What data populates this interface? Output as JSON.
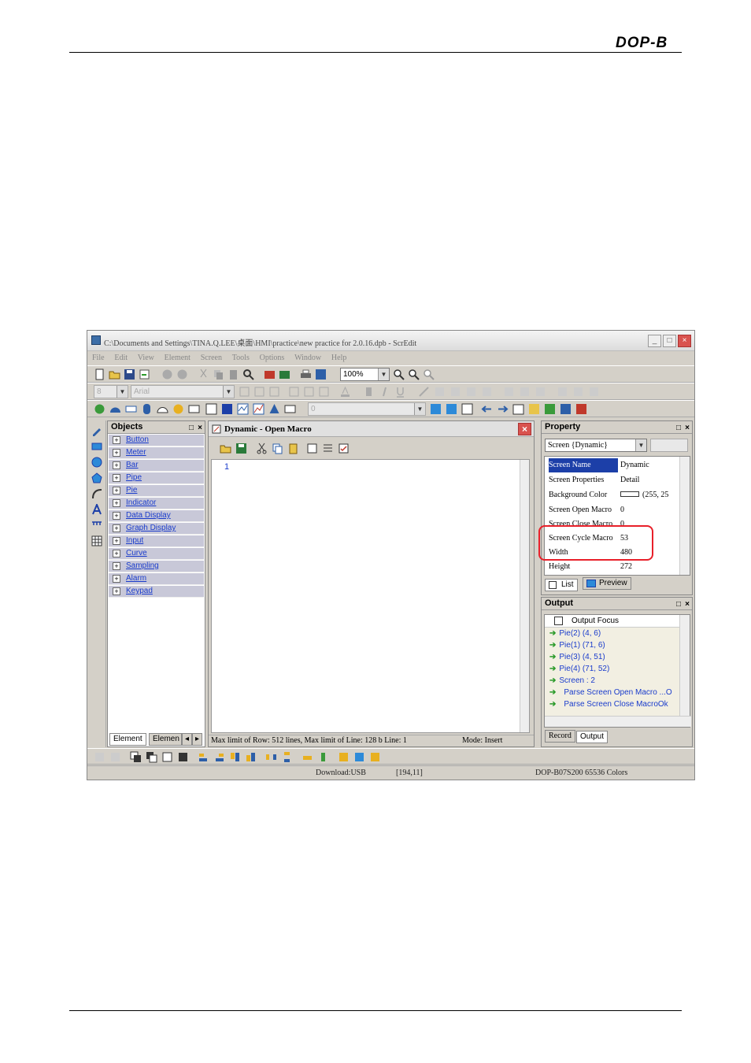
{
  "page": {
    "logo": "DOP-B"
  },
  "window": {
    "title": "C:\\Documents and Settings\\TINA.Q.LEE\\桌面\\HMI\\practice\\new practice for 2.0.16.dpb - ScrEdit",
    "min_label": "_",
    "max_label": "□",
    "close_label": "×"
  },
  "menu": [
    "File",
    "Edit",
    "View",
    "Element",
    "Screen",
    "Tools",
    "Options",
    "Window",
    "Help"
  ],
  "toolbar": {
    "zoom": "100%",
    "font_size": "8",
    "font_name": "Arial",
    "element_combo": "0"
  },
  "objects": {
    "title": "Objects",
    "items": [
      "Button",
      "Meter",
      "Bar",
      "Pipe",
      "Pie",
      "Indicator",
      "Data Display",
      "Graph Display",
      "Input",
      "Curve",
      "Sampling",
      "Alarm",
      "Keypad"
    ],
    "tab1": "Element",
    "tab2": "Elemen"
  },
  "editor": {
    "title": "Dynamic - Open Macro",
    "line1": "1",
    "status_left": "Max limit of Row: 512 lines, Max limit of Line: 128 b Line: 1",
    "status_mode": "Mode: Insert"
  },
  "property": {
    "title": "Property",
    "selector": "Screen {Dynamic}",
    "rows": [
      {
        "key": "Screen Name",
        "value": "Dynamic"
      },
      {
        "key": "Screen Properties",
        "value": "Detail"
      },
      {
        "key": "Background Color",
        "value": "(255, 25"
      },
      {
        "key": "Screen Open Macro",
        "value": "0"
      },
      {
        "key": "Screen Close Macro",
        "value": "0"
      },
      {
        "key": "Screen Cycle Macro",
        "value": "53"
      },
      {
        "key": "Width",
        "value": "480"
      },
      {
        "key": "Height",
        "value": "272"
      }
    ],
    "tab_list": "List",
    "tab_preview": "Preview"
  },
  "output": {
    "title": "Output",
    "focus": "Output Focus",
    "rows": [
      "Pie(2) (4, 6)",
      "Pie(1) (71, 6)",
      "Pie(3) (4, 51)",
      "Pie(4) (71, 52)",
      "Screen : 2",
      "Parse Screen Open Macro ...O",
      "Parse Screen Close MacroOk"
    ],
    "tab_record": "Record",
    "tab_output": "Output"
  },
  "status": {
    "download": "Download:USB",
    "coords": "[194,11]",
    "model": "DOP-B07S200 65536 Colors"
  },
  "colors": {
    "accent": "#1c3fa8",
    "highlight": "#e8202a",
    "chrome": "#d4d0c8"
  }
}
